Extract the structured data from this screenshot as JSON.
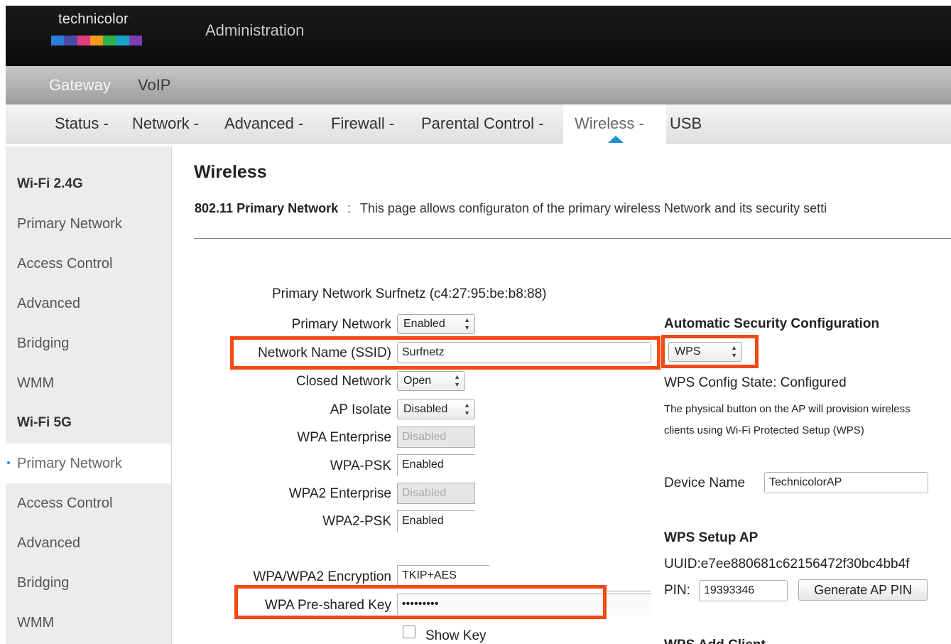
{
  "header": {
    "brand": "technicolor",
    "title": "Administration",
    "brand_colors": [
      "#2a7fd4",
      "#4a4aa8",
      "#e23a7a",
      "#f29b1d",
      "#2bb24c",
      "#1aa3c8",
      "#7a3fb0"
    ]
  },
  "nav_primary": {
    "items": [
      "Gateway",
      "VoIP"
    ],
    "active": "Gateway"
  },
  "nav_secondary": {
    "items": [
      "Status -",
      "Network -",
      "Advanced -",
      "Firewall -",
      "Parental Control -",
      "Wireless -",
      "USB"
    ],
    "active": "Wireless -"
  },
  "sidebar": {
    "items": [
      "Wi-Fi 2.4G",
      "Primary Network",
      "Access Control",
      "Advanced",
      "Bridging",
      "WMM",
      "Wi-Fi 5G",
      "Primary Network",
      "Access Control",
      "Advanced",
      "Bridging",
      "WMM"
    ],
    "active_index": 7
  },
  "main": {
    "title": "Wireless",
    "desc_bold": "802.11 Primary Network",
    "desc_sep": ":",
    "desc_text": "This page allows configuraton of the primary wireless Network and its security setti",
    "network_heading": "Primary Network Surfnetz (c4:27:95:be:b8:88)"
  },
  "form": {
    "primary_network": {
      "label": "Primary Network",
      "value": "Enabled"
    },
    "ssid": {
      "label": "Network Name (SSID)",
      "value": "Surfnetz"
    },
    "closed_network": {
      "label": "Closed Network",
      "value": "Open"
    },
    "ap_isolate": {
      "label": "AP Isolate",
      "value": "Disabled"
    },
    "wpa_enterprise": {
      "label": "WPA Enterprise",
      "value": "Disabled"
    },
    "wpa_psk": {
      "label": "WPA-PSK",
      "value": "Enabled"
    },
    "wpa2_enterprise": {
      "label": "WPA2 Enterprise",
      "value": "Disabled"
    },
    "wpa2_psk": {
      "label": "WPA2-PSK",
      "value": "Enabled"
    },
    "encryption": {
      "label": "WPA/WPA2 Encryption",
      "value": "TKIP+AES"
    },
    "psk": {
      "label": "WPA Pre-shared Key",
      "value": "•••••••••"
    },
    "show_key": {
      "label": "Show Key"
    }
  },
  "right": {
    "auto_sec_heading": "Automatic Security Configuration",
    "auto_sec_value": "WPS",
    "wps_state": "WPS Config State: Configured",
    "wps_note_1": "The physical button on the AP will provision wireless",
    "wps_note_2": "clients using Wi-Fi Protected Setup (WPS)",
    "device_name_label": "Device Name",
    "device_name_value": "TechnicolorAP",
    "setup_heading": "WPS Setup AP",
    "uuid": "UUID:e7ee880681c62156472f30bc4bb4f",
    "pin_label": "PIN:",
    "pin_value": "19393346",
    "generate_button": "Generate AP PIN",
    "add_client_heading": "WPS Add Client"
  },
  "highlight_color": "#f04a16",
  "accent_color": "#1e8fd1"
}
